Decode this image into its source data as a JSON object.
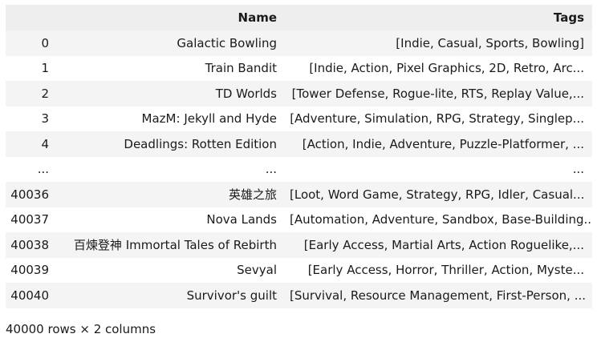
{
  "table": {
    "columns": {
      "index": "",
      "name": "Name",
      "tags": "Tags"
    },
    "rows": [
      {
        "index": "0",
        "name": "Galactic Bowling",
        "tags": "[Indie, Casual, Sports, Bowling]"
      },
      {
        "index": "1",
        "name": "Train Bandit",
        "tags": "[Indie, Action, Pixel Graphics, 2D, Retro, Arc..."
      },
      {
        "index": "2",
        "name": "TD Worlds",
        "tags": "[Tower Defense, Rogue-lite, RTS, Replay Value,..."
      },
      {
        "index": "3",
        "name": "MazM: Jekyll and Hyde",
        "tags": "[Adventure, Simulation, RPG, Strategy, Singlep..."
      },
      {
        "index": "4",
        "name": "Deadlings: Rotten Edition",
        "tags": "[Action, Indie, Adventure, Puzzle-Platformer, ..."
      },
      {
        "index": "...",
        "name": "...",
        "tags": "..."
      },
      {
        "index": "40036",
        "name": "英雄之旅",
        "tags": "[Loot, Word Game, Strategy, RPG, Idler, Casual..."
      },
      {
        "index": "40037",
        "name": "Nova Lands",
        "tags": "[Automation, Adventure, Sandbox, Base-Building..."
      },
      {
        "index": "40038",
        "name": "百煉登神 Immortal Tales of Rebirth",
        "tags": "[Early Access, Martial Arts, Action Roguelike,..."
      },
      {
        "index": "40039",
        "name": "Sevyal",
        "tags": "[Early Access, Horror, Thriller, Action, Myste..."
      },
      {
        "index": "40040",
        "name": "Survivor's guilt",
        "tags": "[Survival, Resource Management, First-Person, ..."
      }
    ]
  },
  "footer": "40000 rows × 2 columns"
}
